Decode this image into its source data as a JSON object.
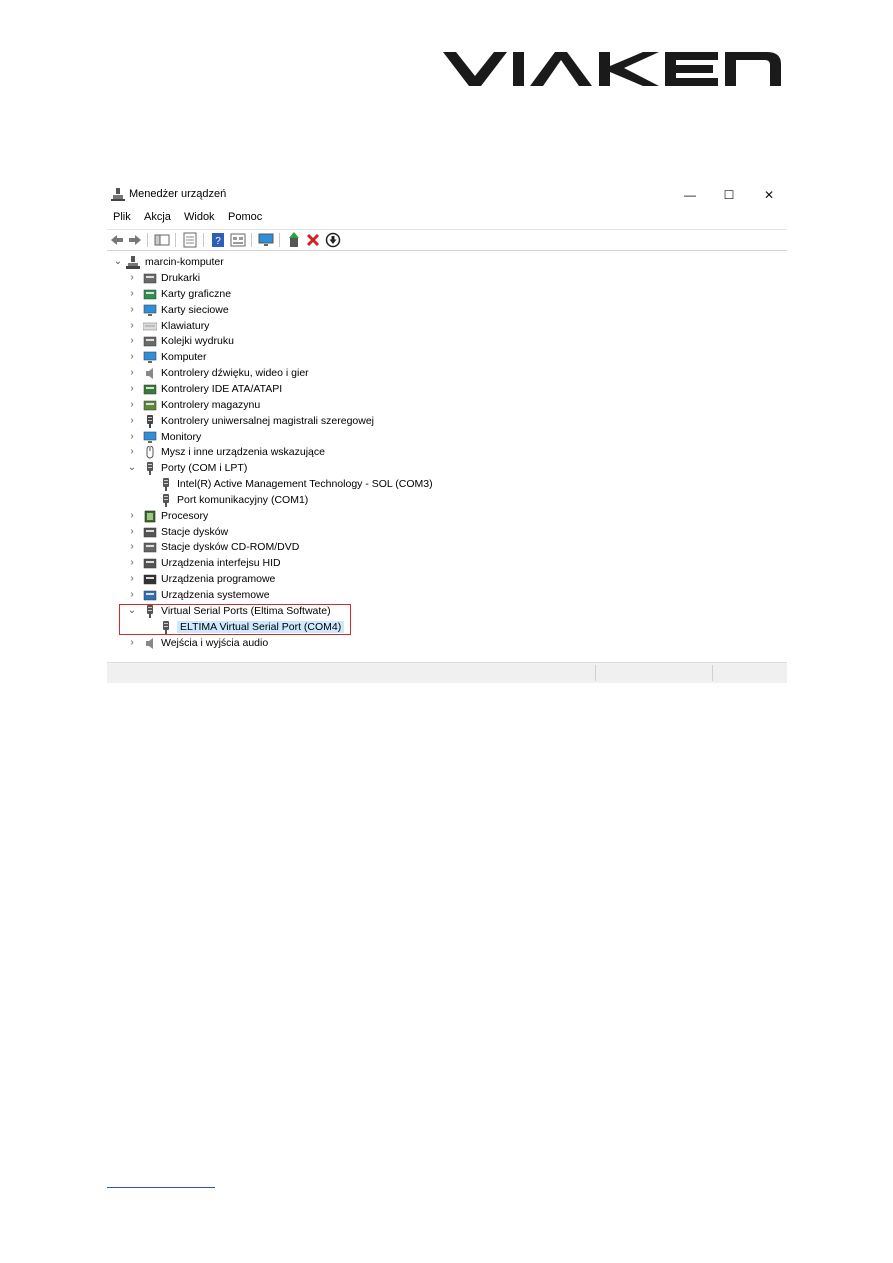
{
  "logo_text": "VIAKEN",
  "window": {
    "title": "Menedżer urządzeń",
    "controls": [
      "—",
      "☐",
      "✕"
    ]
  },
  "menu": [
    "Plik",
    "Akcja",
    "Widok",
    "Pomoc"
  ],
  "toolbar_icons": [
    "back-icon",
    "forward-icon",
    "show-hide-tree-icon",
    "properties-icon",
    "help-icon",
    "view-icon",
    "monitor-icon",
    "update-driver-icon",
    "uninstall-icon",
    "disable-icon"
  ],
  "tree": {
    "root": "marcin-komputer",
    "items": [
      {
        "label": "Drukarki",
        "icon": "printer-icon",
        "expanded": false
      },
      {
        "label": "Karty graficzne",
        "icon": "display-adapter-icon",
        "expanded": false
      },
      {
        "label": "Karty sieciowe",
        "icon": "network-adapter-icon",
        "expanded": false
      },
      {
        "label": "Klawiatury",
        "icon": "keyboard-icon",
        "expanded": false
      },
      {
        "label": "Kolejki wydruku",
        "icon": "print-queue-icon",
        "expanded": false
      },
      {
        "label": "Komputer",
        "icon": "computer-icon",
        "expanded": false
      },
      {
        "label": "Kontrolery dźwięku, wideo i gier",
        "icon": "sound-icon",
        "expanded": false
      },
      {
        "label": "Kontrolery IDE ATA/ATAPI",
        "icon": "ide-icon",
        "expanded": false
      },
      {
        "label": "Kontrolery magazynu",
        "icon": "storage-controller-icon",
        "expanded": false
      },
      {
        "label": "Kontrolery uniwersalnej magistrali szeregowej",
        "icon": "usb-icon",
        "expanded": false
      },
      {
        "label": "Monitory",
        "icon": "monitor-icon",
        "expanded": false
      },
      {
        "label": "Mysz i inne urządzenia wskazujące",
        "icon": "mouse-icon",
        "expanded": false
      },
      {
        "label": "Porty (COM i LPT)",
        "icon": "port-icon",
        "expanded": true
      },
      {
        "label": "Intel(R) Active Management Technology - SOL (COM3)",
        "icon": "port-icon",
        "child": true
      },
      {
        "label": "Port komunikacyjny (COM1)",
        "icon": "port-icon",
        "child": true
      },
      {
        "label": "Procesory",
        "icon": "processor-icon",
        "expanded": false
      },
      {
        "label": "Stacje dysków",
        "icon": "disk-drive-icon",
        "expanded": false
      },
      {
        "label": "Stacje dysków CD-ROM/DVD",
        "icon": "cdrom-icon",
        "expanded": false
      },
      {
        "label": "Urządzenia interfejsu HID",
        "icon": "hid-icon",
        "expanded": false
      },
      {
        "label": "Urządzenia programowe",
        "icon": "software-device-icon",
        "expanded": false
      },
      {
        "label": "Urządzenia systemowe",
        "icon": "system-device-icon",
        "expanded": false
      },
      {
        "label": "Virtual Serial Ports (Eltima Softwate)",
        "icon": "port-icon",
        "expanded": true
      },
      {
        "label": "ELTIMA Virtual Serial Port (COM4)",
        "icon": "port-icon",
        "child": true,
        "selected": true
      },
      {
        "label": "Wejścia i wyjścia audio",
        "icon": "audio-io-icon",
        "expanded": false
      }
    ]
  },
  "colors": {
    "highlight_border": "#d42a2a",
    "selection": "#cde8ff",
    "footer_link": "#2a4fd0"
  }
}
